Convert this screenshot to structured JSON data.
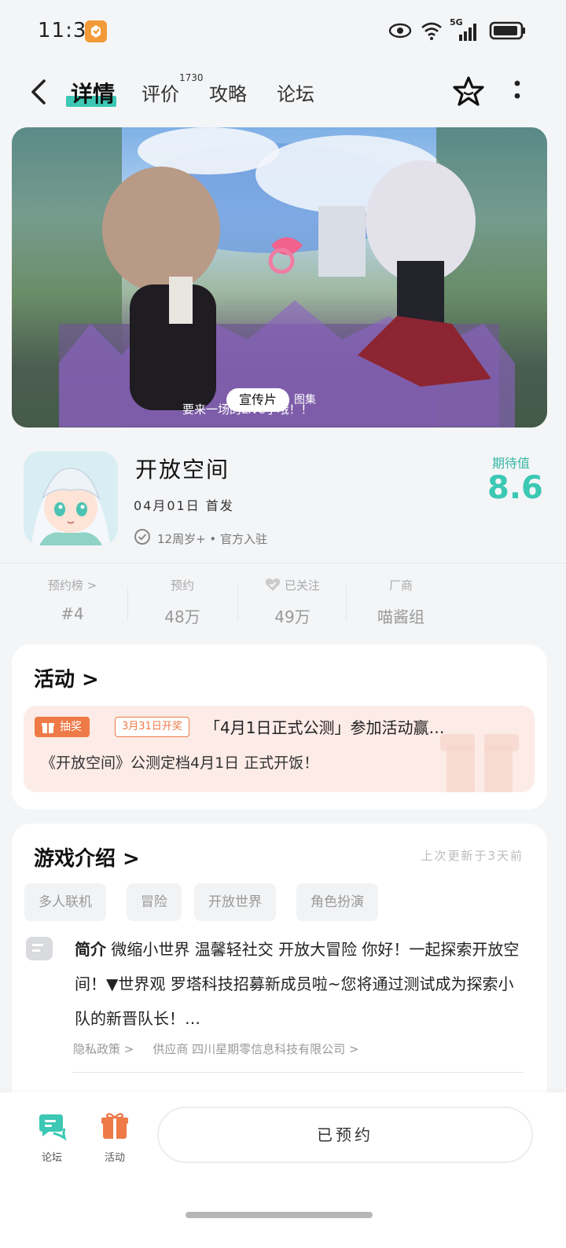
{
  "status": {
    "time": "11:30",
    "network": "5G"
  },
  "nav": {
    "tabs": [
      {
        "label": "详情"
      },
      {
        "label": "评价"
      },
      {
        "label": "攻略"
      },
      {
        "label": "论坛"
      }
    ],
    "review_count": "1730"
  },
  "hero": {
    "tag": "宣传片",
    "tag2": "图集",
    "subtitle": "要来一场的Live了哦！！"
  },
  "app": {
    "name": "开放空间",
    "release": "04月01日 首发",
    "verify": "12周岁+ • 官方入驻",
    "score_label": "期待值",
    "score": "8.6"
  },
  "stats": [
    {
      "label": "预约榜 >",
      "value": "#4"
    },
    {
      "label": "预约",
      "value": "48万"
    },
    {
      "label": "已关注",
      "value": "49万"
    },
    {
      "label": "厂商",
      "value": "喵酱组"
    }
  ],
  "activity": {
    "title": "活动 >",
    "badge": "抽奖",
    "date": "3月31日开奖",
    "promo_title": "「4月1日正式公测」参加活动赢…",
    "promo_desc": "《开放空间》公测定档4月1日 正式开饭！"
  },
  "intro": {
    "title": "游戏介绍 >",
    "updated": "上次更新于3天前",
    "tags": [
      "多人联机",
      "冒险",
      "开放世界",
      "角色扮演"
    ],
    "lead": "简介",
    "text": " 微缩小世界 温馨轻社交 开放大冒险 你好！一起探索开放空间！▼世界观 罗塔科技招募新成员啦~您将通过测试成为探索小队的新晋队长！…",
    "privacy": "隐私政策 >",
    "supplier": "供应商 四川星期零信息科技有限公司 >"
  },
  "bottom": {
    "forum_label": "论坛",
    "activity_label": "活动",
    "reserve_label": "已预约"
  },
  "colors": {
    "accent": "#3cc8b4",
    "orange": "#ee7a47"
  }
}
